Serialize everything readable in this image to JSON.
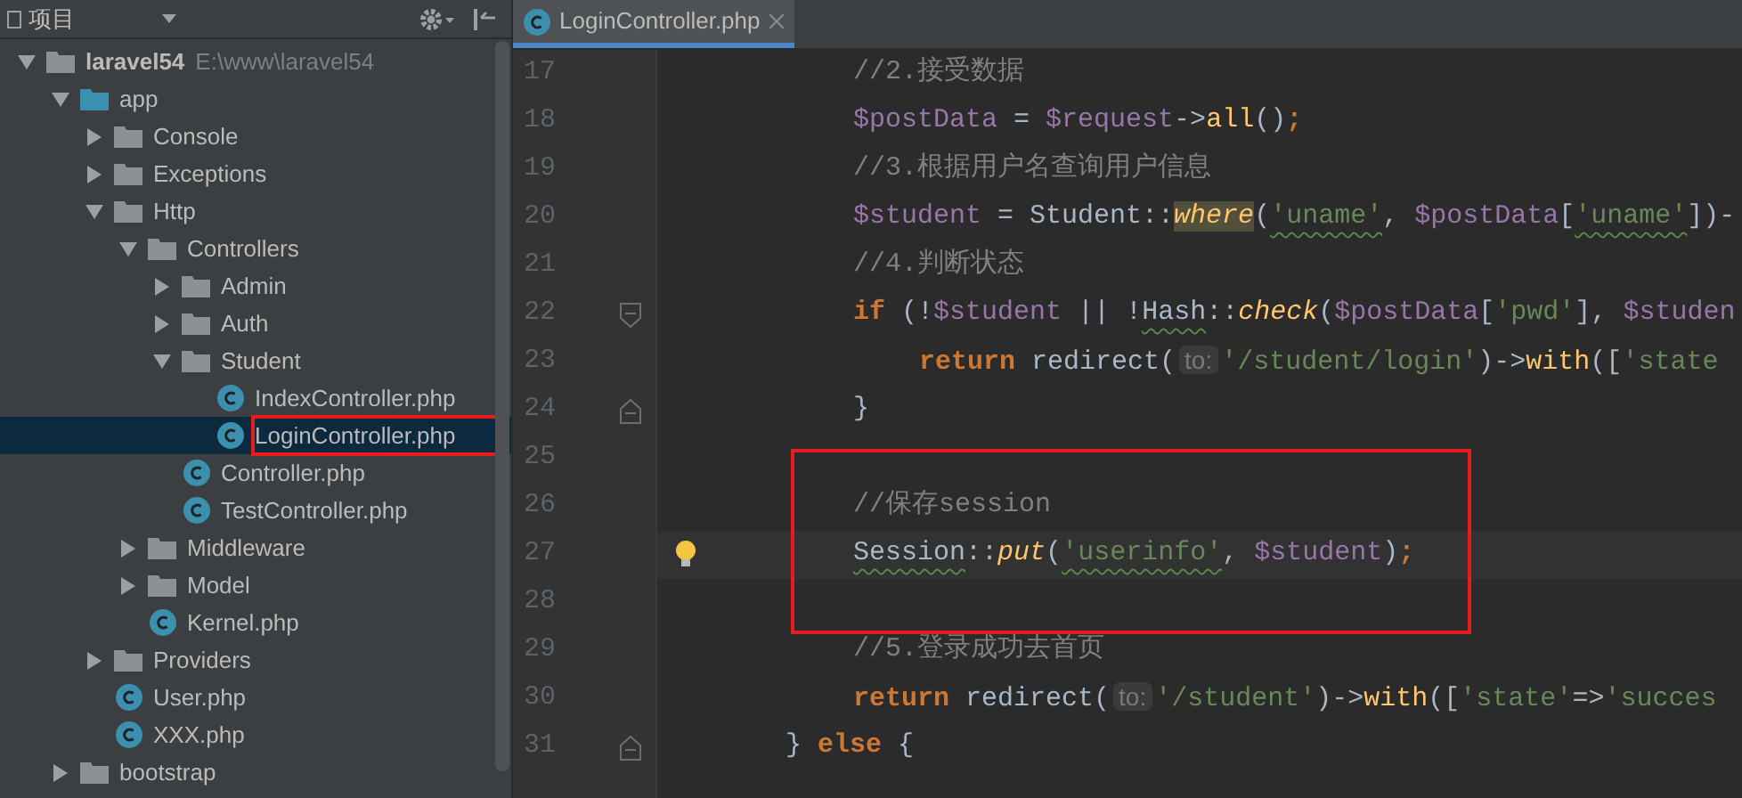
{
  "sidebar": {
    "title": "项目",
    "tree": [
      {
        "name": "laravel54",
        "kind": "project",
        "path": "E:\\www\\laravel54",
        "expanded": true,
        "children": [
          {
            "name": "app",
            "kind": "source_folder",
            "expanded": true,
            "children": [
              {
                "name": "Console",
                "kind": "folder",
                "expanded": false
              },
              {
                "name": "Exceptions",
                "kind": "folder",
                "expanded": false
              },
              {
                "name": "Http",
                "kind": "folder",
                "expanded": true,
                "children": [
                  {
                    "name": "Controllers",
                    "kind": "folder",
                    "expanded": true,
                    "children": [
                      {
                        "name": "Admin",
                        "kind": "folder",
                        "expanded": false
                      },
                      {
                        "name": "Auth",
                        "kind": "folder",
                        "expanded": false
                      },
                      {
                        "name": "Student",
                        "kind": "folder",
                        "expanded": true,
                        "children": [
                          {
                            "name": "IndexController.php",
                            "kind": "file",
                            "selected": false,
                            "marked": false
                          },
                          {
                            "name": "LoginController.php",
                            "kind": "file",
                            "selected": true,
                            "marked": true
                          }
                        ]
                      },
                      {
                        "name": "Controller.php",
                        "kind": "file",
                        "selected": false,
                        "marked": false
                      },
                      {
                        "name": "TestController.php",
                        "kind": "file",
                        "selected": false,
                        "marked": false
                      }
                    ]
                  },
                  {
                    "name": "Middleware",
                    "kind": "folder",
                    "expanded": false
                  },
                  {
                    "name": "Model",
                    "kind": "folder",
                    "expanded": false
                  },
                  {
                    "name": "Kernel.php",
                    "kind": "file",
                    "selected": false,
                    "marked": false
                  }
                ]
              },
              {
                "name": "Providers",
                "kind": "folder",
                "expanded": false
              },
              {
                "name": "User.php",
                "kind": "file",
                "selected": false,
                "marked": false
              },
              {
                "name": "XXX.php",
                "kind": "file",
                "selected": false,
                "marked": false
              }
            ]
          },
          {
            "name": "bootstrap",
            "kind": "folder",
            "expanded": false
          }
        ]
      }
    ]
  },
  "tabs": [
    {
      "label": "LoginController.php",
      "selected": true
    }
  ],
  "editor": {
    "lines": [
      {
        "number": "17",
        "kind": "body",
        "tokens": [
          {
            "text": "//2.接受数据",
            "kind": "comment"
          }
        ]
      },
      {
        "number": "18",
        "kind": "body",
        "tokens": [
          {
            "text": "$postData",
            "kind": "var"
          },
          {
            "text": " = ",
            "kind": "plain"
          },
          {
            "text": "$request",
            "kind": "var"
          },
          {
            "text": "->",
            "kind": "plain"
          },
          {
            "text": "all",
            "kind": "method"
          },
          {
            "text": "()",
            "kind": "plain"
          },
          {
            "text": ";",
            "kind": "keyword"
          }
        ]
      },
      {
        "number": "19",
        "kind": "body",
        "tokens": [
          {
            "text": "//3.根据用户名查询用户信息",
            "kind": "comment"
          }
        ]
      },
      {
        "number": "20",
        "kind": "body",
        "tokens": [
          {
            "text": "$student",
            "kind": "var"
          },
          {
            "text": " = Student::",
            "kind": "plain"
          },
          {
            "text": "where",
            "kind": "static",
            "highlight": true
          },
          {
            "text": "(",
            "kind": "plain"
          },
          {
            "text": "'uname'",
            "kind": "string",
            "squiggle": true
          },
          {
            "text": ", ",
            "kind": "plain"
          },
          {
            "text": "$postData",
            "kind": "var"
          },
          {
            "text": "[",
            "kind": "plain"
          },
          {
            "text": "'uname'",
            "kind": "string",
            "squiggle": true
          },
          {
            "text": "])-",
            "kind": "plain"
          }
        ]
      },
      {
        "number": "21",
        "kind": "body",
        "tokens": [
          {
            "text": "//4.判断状态",
            "kind": "comment"
          }
        ]
      },
      {
        "number": "22",
        "kind": "body",
        "fold_start": true,
        "tokens": [
          {
            "text": "if",
            "kind": "keyword"
          },
          {
            "text": " (!",
            "kind": "plain"
          },
          {
            "text": "$student",
            "kind": "var"
          },
          {
            "text": " || !",
            "kind": "plain"
          },
          {
            "text": "Hash",
            "kind": "plain",
            "squiggle": true
          },
          {
            "text": "::",
            "kind": "plain"
          },
          {
            "text": "check",
            "kind": "static"
          },
          {
            "text": "(",
            "kind": "plain"
          },
          {
            "text": "$postData",
            "kind": "var"
          },
          {
            "text": "[",
            "kind": "plain"
          },
          {
            "text": "'pwd'",
            "kind": "string"
          },
          {
            "text": "], ",
            "kind": "plain"
          },
          {
            "text": "$studen",
            "kind": "var"
          }
        ]
      },
      {
        "number": "23",
        "kind": "nested",
        "tokens": [
          {
            "text": "return",
            "kind": "keyword"
          },
          {
            "text": " redirect(",
            "kind": "plain"
          },
          {
            "text": "to:",
            "kind": "hint"
          },
          {
            "text": "'/student/login'",
            "kind": "string"
          },
          {
            "text": ")->",
            "kind": "plain"
          },
          {
            "text": "with",
            "kind": "method"
          },
          {
            "text": "([",
            "kind": "plain"
          },
          {
            "text": "'state",
            "kind": "string"
          }
        ]
      },
      {
        "number": "24",
        "kind": "body",
        "fold_end": true,
        "tokens": [
          {
            "text": "}",
            "kind": "plain"
          }
        ]
      },
      {
        "number": "25",
        "boxed": true
      },
      {
        "number": "26",
        "kind": "body",
        "boxed": true,
        "tokens": [
          {
            "text": "//保存session",
            "kind": "comment"
          }
        ]
      },
      {
        "number": "27",
        "kind": "body",
        "boxed": true,
        "current": true,
        "intention": true,
        "tokens": [
          {
            "text": "Session",
            "kind": "plain",
            "squiggle": true
          },
          {
            "text": "::",
            "kind": "plain"
          },
          {
            "text": "put",
            "kind": "static"
          },
          {
            "text": "(",
            "kind": "plain"
          },
          {
            "text": "'userinfo'",
            "kind": "string",
            "squiggle": true
          },
          {
            "text": ", ",
            "kind": "plain"
          },
          {
            "text": "$student",
            "kind": "var"
          },
          {
            "text": ")",
            "kind": "plain"
          },
          {
            "text": ";",
            "kind": "keyword"
          }
        ]
      },
      {
        "number": "28",
        "boxed": true
      },
      {
        "number": "29",
        "kind": "body",
        "tokens": [
          {
            "text": "//5.登录成功去首页",
            "kind": "comment"
          }
        ]
      },
      {
        "number": "30",
        "kind": "body",
        "tokens": [
          {
            "text": "return",
            "kind": "keyword"
          },
          {
            "text": " redirect(",
            "kind": "plain"
          },
          {
            "text": "to:",
            "kind": "hint"
          },
          {
            "text": "'/student'",
            "kind": "string"
          },
          {
            "text": ")->",
            "kind": "plain"
          },
          {
            "text": "with",
            "kind": "method"
          },
          {
            "text": "([",
            "kind": "plain"
          },
          {
            "text": "'state'",
            "kind": "string"
          },
          {
            "text": "=>",
            "kind": "plain"
          },
          {
            "text": "'succes",
            "kind": "string"
          }
        ]
      },
      {
        "number": "31",
        "kind": "outer",
        "fold_end": true,
        "tokens": [
          {
            "text": "} ",
            "kind": "plain"
          },
          {
            "text": "else",
            "kind": "keyword"
          },
          {
            "text": " {",
            "kind": "plain"
          }
        ]
      }
    ]
  }
}
